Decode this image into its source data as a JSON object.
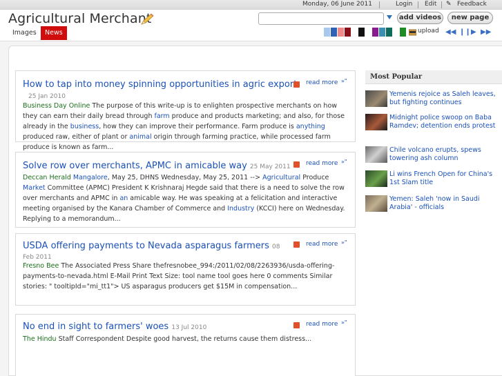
{
  "topbar": {
    "date": "Monday, 06 June 2011",
    "login": "Login",
    "edit": "Edit",
    "feedback": "Feedback"
  },
  "header": {
    "site_title": "Agricultural Merchant",
    "search_placeholder": "",
    "add_videos": "add videos",
    "new_page": "new page",
    "tabs": [
      {
        "label": "Images",
        "active": false
      },
      {
        "label": "News",
        "active": true
      }
    ],
    "upload": "upload",
    "swatches": [
      "#a9c8ee",
      "#2f62b5",
      "#f08a8a",
      "#8a0f18",
      "#ffffff",
      "#111111",
      "#ffffff",
      "#8a1b8f",
      "#3d8fb0",
      "#0f6b5c",
      "#1e8c24"
    ],
    "media_controls": [
      "prev",
      "pause",
      "play",
      "next"
    ]
  },
  "articles": [
    {
      "title": "How to tap into money spinning opportunities in agric export",
      "date": "25 Jan 2010",
      "read_more": "read more",
      "source": "Business Day Online",
      "body": [
        {
          "t": "The purpose of this write-up is to enlighten prospective merchants on how they can earn their daily bread through ",
          "k": false
        },
        {
          "t": "farm",
          "k": true
        },
        {
          "t": " produce and products marketing; and also, for those already in the ",
          "k": false
        },
        {
          "t": "business",
          "k": true
        },
        {
          "t": ", how they can improve their performance. Farm produce is ",
          "k": false
        },
        {
          "t": "anything",
          "k": true
        },
        {
          "t": " produced raw, either of plant or ",
          "k": false
        },
        {
          "t": "animal",
          "k": true
        },
        {
          "t": " origin through farming practice, while processed farm produce is known as farm...",
          "k": false
        }
      ]
    },
    {
      "title": "Solve row over merchants, APMC in amicable way",
      "date": "25 May 2011",
      "read_more": "read more",
      "source": "Deccan Herald",
      "body": [
        {
          "t": "Mangalore",
          "k": true
        },
        {
          "t": ", May 25, DHNS Wednesday, May 25, 2011 --> ",
          "k": false
        },
        {
          "t": "Agricultural",
          "k": true
        },
        {
          "t": " Produce ",
          "k": false
        },
        {
          "t": "Market",
          "k": true
        },
        {
          "t": " Committee (APMC) President K Krishnaraj Hegde said that there is a need to solve the row over merchants and APMC in ",
          "k": false
        },
        {
          "t": "an",
          "k": true
        },
        {
          "t": " amicable way. He was speaking at a felicitation and interactive meeting organised by the Kanara Chamber of Commerce and ",
          "k": false
        },
        {
          "t": "Industry",
          "k": true
        },
        {
          "t": " (KCCI) here on Wednesday. Replying to a memorandum...",
          "k": false
        }
      ]
    },
    {
      "title": "USDA offering payments to Nevada asparagus farmers",
      "date": "08 Feb 2011",
      "read_more": "read more",
      "source": "Fresno Bee",
      "body": [
        {
          "t": "The Associated Press Share thefresnobee_994:/2011/02/08/2263936/usda-offering-payments-to-nevada.html E-Mail Print Text Size: tool name tool goes here 0 comments Similar stories: \" tooltipId=\"mi_tt1\"> US asparagus producers get $15M in compensation...",
          "k": false
        }
      ]
    },
    {
      "title": "No end in sight to farmers' woes",
      "date": "13 Jul 2010",
      "read_more": "read more",
      "source": "The Hindu",
      "body": [
        {
          "t": "Staff Correspondent Despite good harvest, the returns cause them distress...",
          "k": false
        }
      ]
    }
  ],
  "sidebar": {
    "heading": "Most Popular",
    "items": [
      {
        "text": "Yemenis rejoice as Saleh leaves, but fighting continues"
      },
      {
        "text": "Midnight police swoop on Baba Ramdev; detention ends protest"
      },
      {
        "text": "Chile volcano erupts, spews towering ash column"
      },
      {
        "text": "Li wins French Open for China's 1st Slam title"
      },
      {
        "text": "Yemen: Saleh 'now in Saudi Arabia' - officials"
      }
    ]
  }
}
